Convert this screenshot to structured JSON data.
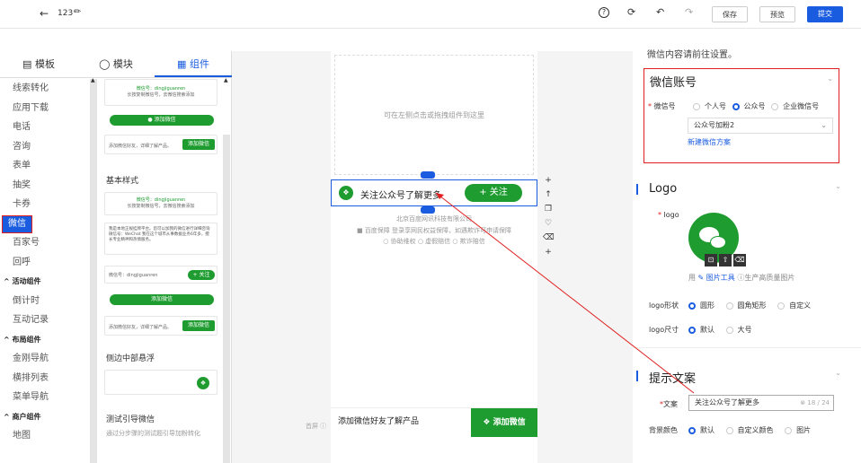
{
  "topbar": {
    "back_icon": "arrow-left-icon",
    "title": "123",
    "edit_icon": "pencil-icon",
    "help_icon": "question-circle-icon",
    "share_icon": "share-icon",
    "undo_icon": "undo-icon",
    "redo_icon": "redo-icon",
    "save": "保存",
    "preview": "预览",
    "submit": "提交"
  },
  "sidebar": {
    "tabs": [
      {
        "label": "模板",
        "icon": "template-icon"
      },
      {
        "label": "模块",
        "icon": "module-icon"
      },
      {
        "label": "组件",
        "icon": "grid-icon"
      }
    ],
    "nav": [
      {
        "label": "线索转化"
      },
      {
        "label": "应用下载"
      },
      {
        "label": "电话"
      },
      {
        "label": "咨询"
      },
      {
        "label": "表单"
      },
      {
        "label": "抽奖"
      },
      {
        "label": "卡券"
      },
      {
        "label": "微信",
        "selected": true
      },
      {
        "label": "百家号"
      },
      {
        "label": "回呼"
      },
      {
        "label": "活动组件",
        "group": true
      },
      {
        "label": "倒计时"
      },
      {
        "label": "互动记录"
      },
      {
        "label": "布局组件",
        "group": true
      },
      {
        "label": "金刚导航"
      },
      {
        "label": "横排列表"
      },
      {
        "label": "菜单导航"
      },
      {
        "label": "商户组件",
        "group": true
      },
      {
        "label": "地图"
      }
    ],
    "panel": {
      "card1_wechat": "微信号：dingjiguanren",
      "card1_sub": "长按复制微信号，去微信搜索添加",
      "card1_btn": "添加微信",
      "bar_text": "添加微信好友，详细了解产品。",
      "bar_btn": "添加微信",
      "basic_style": "基本样式",
      "card2_wechat": "微信号：dingjiguanren",
      "card2_sub": "长按复制微信号，去微信搜索添加",
      "card3_text": "我是本地正规挂牌平台。您可以加我的微信进行详细咨询 微信号：WeChat 我在这个城市从事数据业务6年多，擅长专业精神和热情服务。",
      "row_wechat": "微信号：dingjiguanren",
      "row_btn": "+ 关注",
      "card4_btn": "添加微信",
      "bar2_text": "添加微信好友，详细了解产品。",
      "bar2_btn": "添加微信",
      "side_float": "侧边中部悬浮",
      "guide_title": "测试引导微信",
      "guide_sub": "通过分步骤的测试题引导加粉转化"
    }
  },
  "canvas": {
    "drop_hint": "可在左侧点击或拖拽组件到这里",
    "follow_text": "关注公众号了解更多",
    "follow_btn": "+ 关注",
    "company": "北京百度网讯科技有限公司",
    "guarantee": "百度保障 登录享网民权益保障，如遇欺诈可申请保障",
    "guarantee_link": "申请保障",
    "protect": [
      "协助维权",
      "虚假赔信",
      "欺诈赔信"
    ],
    "homepage": "首屏",
    "bottom_text": "添加微信好友了解产品",
    "bottom_btn": "添加微信",
    "tools": [
      "plus-icon",
      "arrow-up-icon",
      "copy-icon",
      "heart-icon",
      "trash-icon",
      "plus-icon"
    ]
  },
  "right": {
    "top_text": "微信内容请前往设置。",
    "wechat_title": "微信账号",
    "wechat_label": "微信号",
    "wechat_options": [
      "个人号",
      "公众号",
      "企业微信号"
    ],
    "wechat_selected": 1,
    "account_value": "公众号加粉2",
    "new_plan": "新建微信方案",
    "logo_title": "Logo",
    "logo_label": "logo",
    "logo_tools_prefix": "用",
    "logo_tools_link": "图片工具",
    "logo_tools_suffix": "生产高质量图片",
    "shape_label": "logo形状",
    "shape_options": [
      "圆形",
      "圆角矩形",
      "自定义"
    ],
    "shape_selected": 0,
    "size_label": "logo尺寸",
    "size_options": [
      "默认",
      "大号"
    ],
    "size_selected": 0,
    "tip_title": "提示文案",
    "text_label": "文案",
    "text_value": "关注公众号了解更多",
    "text_count": "18 / 24",
    "bg_label": "背景颜色",
    "bg_options": [
      "默认",
      "自定义颜色",
      "图片"
    ],
    "bg_selected": 0
  },
  "colors": {
    "accent": "#1a5ce0",
    "green": "#1f9c30",
    "highlight": "#e02020"
  }
}
